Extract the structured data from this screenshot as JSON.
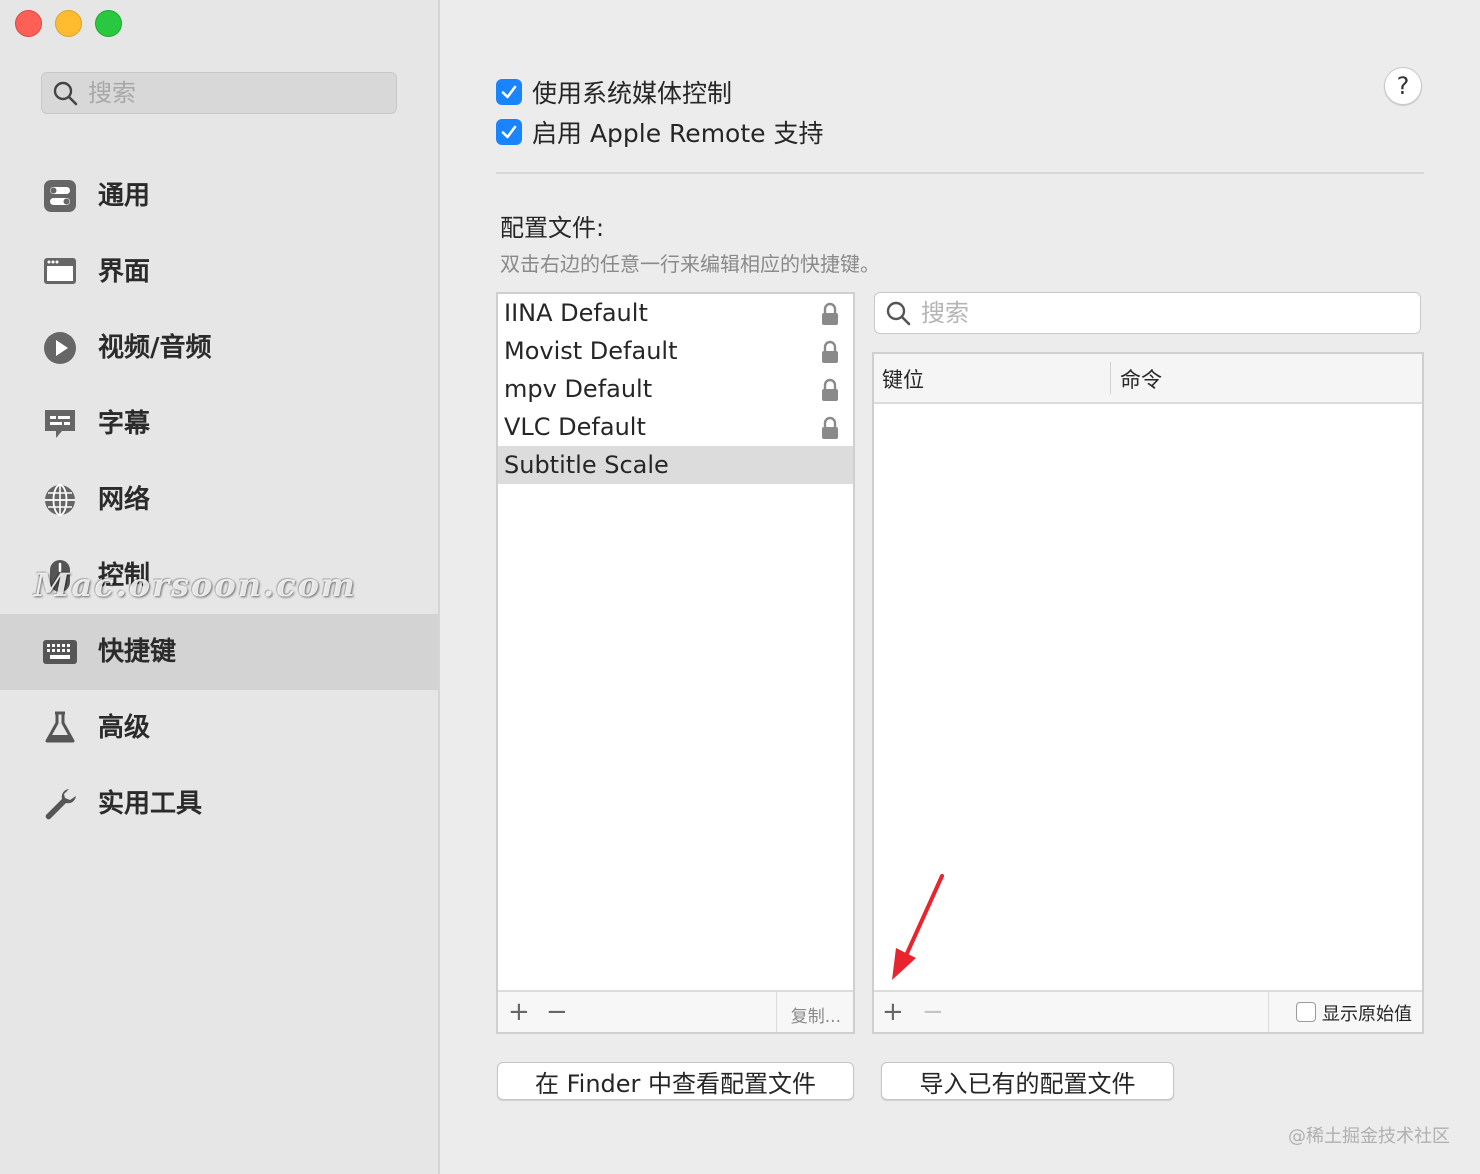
{
  "window": {
    "credit": "@稀土掘金技术社区"
  },
  "sidebar": {
    "search_placeholder": "搜索",
    "items": [
      {
        "label": "通用",
        "icon": "toggle-switches-icon"
      },
      {
        "label": "界面",
        "icon": "window-icon"
      },
      {
        "label": "视频/音频",
        "icon": "play-icon"
      },
      {
        "label": "字幕",
        "icon": "subtitle-bubble-icon"
      },
      {
        "label": "网络",
        "icon": "globe-icon"
      },
      {
        "label": "控制",
        "icon": "mouse-icon"
      },
      {
        "label": "快捷键",
        "icon": "keyboard-icon",
        "selected": true
      },
      {
        "label": "高级",
        "icon": "flask-icon"
      },
      {
        "label": "实用工具",
        "icon": "wrench-icon"
      }
    ],
    "watermark": "Mac.orsoon.com"
  },
  "main": {
    "options": [
      {
        "label": "使用系统媒体控制",
        "checked": true
      },
      {
        "label": "启用 Apple Remote 支持",
        "checked": true
      }
    ],
    "help_label": "?",
    "profiles_title": "配置文件:",
    "profiles_hint": "双击右边的任意一行来编辑相应的快捷键。",
    "profiles": [
      {
        "name": "IINA Default",
        "locked": true
      },
      {
        "name": "Movist Default",
        "locked": true
      },
      {
        "name": "mpv Default",
        "locked": true
      },
      {
        "name": "VLC Default",
        "locked": true
      },
      {
        "name": "Subtitle Scale",
        "locked": false,
        "selected": true
      }
    ],
    "list_footer": {
      "add": "+",
      "remove": "−",
      "duplicate": "复制..."
    },
    "key_search_placeholder": "搜索",
    "table": {
      "col_key": "键位",
      "col_command": "命令",
      "rows": [],
      "footer": {
        "add": "+",
        "remove": "−",
        "show_raw_label": "显示原始值",
        "show_raw_checked": false
      }
    },
    "buttons": {
      "show_in_finder": "在 Finder 中查看配置文件",
      "import_profile": "导入已有的配置文件"
    }
  },
  "colors": {
    "accent": "#1a84ff",
    "annotation_arrow": "#e8242c"
  }
}
